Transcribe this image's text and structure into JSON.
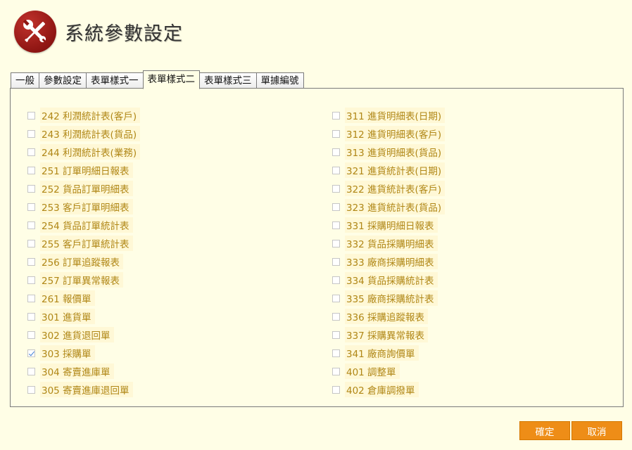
{
  "header": {
    "title": "系統參數設定"
  },
  "tabs": [
    {
      "label": "一般",
      "active": false
    },
    {
      "label": "參數設定",
      "active": false
    },
    {
      "label": "表單樣式一",
      "active": false
    },
    {
      "label": "表單樣式二",
      "active": true
    },
    {
      "label": "表單樣式三",
      "active": false
    },
    {
      "label": "單據編號",
      "active": false
    }
  ],
  "left_items": [
    {
      "label": "242 利潤統計表(客戶)",
      "checked": false
    },
    {
      "label": "243 利潤統計表(貨品)",
      "checked": false
    },
    {
      "label": "244 利潤統計表(業務)",
      "checked": false
    },
    {
      "label": "251 訂單明細日報表",
      "checked": false
    },
    {
      "label": "252 貨品訂單明細表",
      "checked": false
    },
    {
      "label": "253 客戶訂單明細表",
      "checked": false
    },
    {
      "label": "254 貨品訂單統計表",
      "checked": false
    },
    {
      "label": "255 客戶訂單統計表",
      "checked": false
    },
    {
      "label": "256 訂單追蹤報表",
      "checked": false
    },
    {
      "label": "257 訂單異常報表",
      "checked": false
    },
    {
      "label": "261 報價單",
      "checked": false
    },
    {
      "label": "301 進貨單",
      "checked": false
    },
    {
      "label": "302 進貨退回單",
      "checked": false
    },
    {
      "label": "303 採購單",
      "checked": true
    },
    {
      "label": "304 寄賣進庫單",
      "checked": false
    },
    {
      "label": "305 寄賣進庫退回單",
      "checked": false
    }
  ],
  "right_items": [
    {
      "label": "311 進貨明細表(日期)",
      "checked": false
    },
    {
      "label": "312 進貨明細表(客戶)",
      "checked": false
    },
    {
      "label": "313 進貨明細表(貨品)",
      "checked": false
    },
    {
      "label": "321 進貨統計表(日期)",
      "checked": false
    },
    {
      "label": "322 進貨統計表(客戶)",
      "checked": false
    },
    {
      "label": "323 進貨統計表(貨品)",
      "checked": false
    },
    {
      "label": "331 採購明細日報表",
      "checked": false
    },
    {
      "label": "332 貨品採購明細表",
      "checked": false
    },
    {
      "label": "333 廠商採購明細表",
      "checked": false
    },
    {
      "label": "334 貨品採購統計表",
      "checked": false
    },
    {
      "label": "335 廠商採購統計表",
      "checked": false
    },
    {
      "label": "336 採購追蹤報表",
      "checked": false
    },
    {
      "label": "337 採購異常報表",
      "checked": false
    },
    {
      "label": "341 廠商詢價單",
      "checked": false
    },
    {
      "label": "401 調整單",
      "checked": false
    },
    {
      "label": "402 倉庫調撥單",
      "checked": false
    }
  ],
  "buttons": {
    "ok": "確定",
    "cancel": "取消"
  },
  "colors": {
    "background": "#fffee6",
    "label_text": "#b08716",
    "button": "#ee8d17",
    "logo": "#8e1512"
  },
  "icons": {
    "logo": "tools-wrench-screwdriver-icon"
  }
}
